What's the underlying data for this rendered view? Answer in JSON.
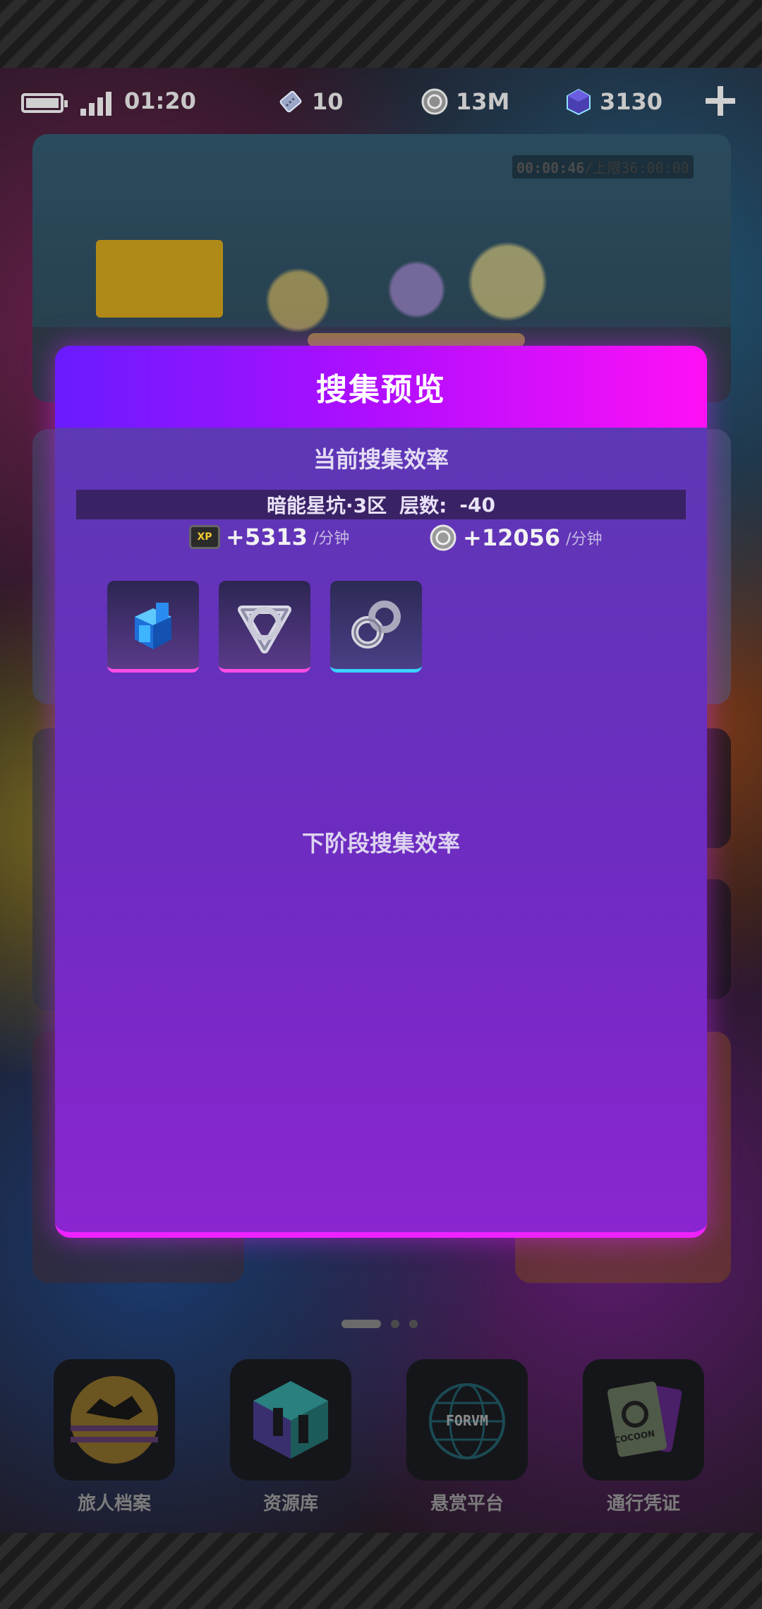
{
  "status_bar": {
    "time": "01:20",
    "resources": [
      {
        "icon": "ticket-icon",
        "value": "10"
      },
      {
        "icon": "coin-icon",
        "value": "13M"
      },
      {
        "icon": "crystal-cube-icon",
        "value": "3130"
      }
    ]
  },
  "banner": {
    "timer_elapsed": "00:00:46",
    "timer_limit": "/上限36:00:00"
  },
  "modal": {
    "title": "搜集预览",
    "current_section_title": "当前搜集效率",
    "zone_name": "暗能星坑·3区",
    "depth_label": "层数:",
    "depth_value": "-40",
    "xp_icon_text": "XP",
    "xp_rate": "+5313",
    "coin_rate": "+12056",
    "rate_unit": "/分钟",
    "items": [
      {
        "name": "blue-block-cube-icon",
        "rarity_color": "#ff4de5"
      },
      {
        "name": "triangle-ring-icon",
        "rarity_color": "#ff4de5"
      },
      {
        "name": "infinity-chain-icon",
        "rarity_color": "#3ad1ff"
      }
    ],
    "next_section_title": "下阶段搜集效率"
  },
  "dock": [
    {
      "label": "旅人档案",
      "icon": "traveler-archive-icon"
    },
    {
      "label": "资源库",
      "icon": "resource-library-icon"
    },
    {
      "label": "悬赏平台",
      "icon": "forum-globe-icon",
      "icon_text": "FORVM"
    },
    {
      "label": "通行凭证",
      "icon": "pass-card-icon",
      "icon_text": "COCOON"
    }
  ],
  "colors": {
    "modal_header_start": "#6a1bff",
    "modal_header_end": "#ff10f5",
    "modal_body": "#6d2cc0",
    "rarity_purple": "#ff4de5",
    "rarity_blue": "#3ad1ff"
  }
}
